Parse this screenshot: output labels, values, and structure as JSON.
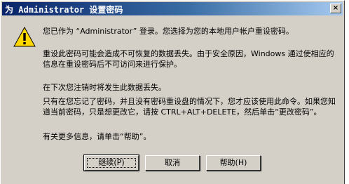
{
  "window": {
    "title": "为 Administrator 设置密码",
    "close_label": "×"
  },
  "message": {
    "p1": "您已作为 “Administrator” 登录。您选择为您的本地用户帐户重设密码。",
    "p2": "重设此密码可能会造成不可恢复的数据丢失。由于安全原因，Windows 通过使相应的信息在重设密码后不可访问来进行保护。",
    "p3": "在下次您注销时将发生此数据丢失。",
    "p4": "只有在您忘记了密码，并且没有密码重设盘的情况下，您才应该使用此命令。如果您知道当前密码，只是想更改它，请按 CTRL+ALT+DELETE，然后单击“更改密码”。",
    "p5": "有关更多信息，请单击“帮助”。"
  },
  "buttons": {
    "continue_label": "继续(P)",
    "cancel_label": "取消",
    "help_label": "帮助(H)"
  },
  "icons": {
    "warning": "warning-icon"
  }
}
